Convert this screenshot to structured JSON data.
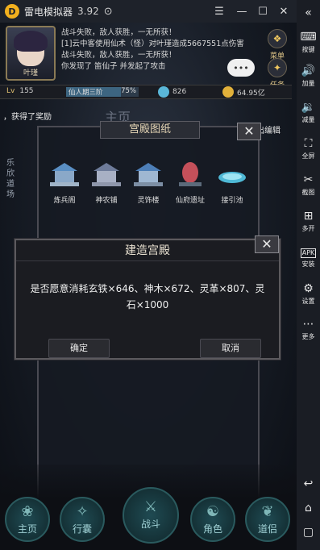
{
  "emulator": {
    "app_name": "雷电模拟器",
    "version": "3.92",
    "logo_glyph": "D",
    "window_buttons": [
      "☰",
      "—",
      "☐",
      "✕"
    ],
    "sidebar": [
      {
        "icon": "«",
        "label": ""
      },
      {
        "icon": "⌨",
        "label": "按键"
      },
      {
        "icon": "🔊",
        "label": "加量"
      },
      {
        "icon": "🔉",
        "label": "减量"
      },
      {
        "icon": "⛶",
        "label": "全屏"
      },
      {
        "icon": "✂",
        "label": "截图"
      },
      {
        "icon": "⊞",
        "label": "多开"
      },
      {
        "icon": "APK",
        "label": "安装"
      },
      {
        "icon": "⚙",
        "label": "设置"
      },
      {
        "icon": "⋯",
        "label": "更多"
      },
      {
        "icon": "↩",
        "label": ""
      },
      {
        "icon": "⌂",
        "label": ""
      },
      {
        "icon": "▢",
        "label": ""
      }
    ]
  },
  "player": {
    "name": "叶瑾",
    "level_label": "Lv",
    "level": "155",
    "realm": "仙人期三阶",
    "realm_progress": "75%",
    "realm_progress_value": 75,
    "spirit_stone": "826",
    "gold": "64.95亿"
  },
  "combat_log": [
    "战斗失败，敌人获胜，一无所获！",
    "[1]云中客使用仙术（怪）对叶瑾造成5667551点伤害",
    "战斗失败，敌人获胜，一无所获！",
    "你发现了 笛仙子 并发起了攻击"
  ],
  "top_buttons": {
    "menu": "菜单",
    "task": "任务",
    "chat_bubble": "•••"
  },
  "notices": {
    "got_reward": "，获得了奖励",
    "main_bg": "主页",
    "side_tab": "乐欣道场",
    "edit": "出编辑"
  },
  "blueprint_panel": {
    "title": "宫殿图纸",
    "buildings": [
      {
        "label": "炼兵阁"
      },
      {
        "label": "神农铺"
      },
      {
        "label": "灵饰楼"
      },
      {
        "label": "仙府遗址"
      },
      {
        "label": "接引池"
      }
    ]
  },
  "build_dialog": {
    "title": "建造宫殿",
    "message": "是否愿意消耗玄铁×646、神木×672、灵革×807、灵石×1000",
    "confirm": "确定",
    "cancel": "取消"
  },
  "close_glyph": "✕",
  "bottom_nav": [
    {
      "label": "主页",
      "icon": "❀"
    },
    {
      "label": "行囊",
      "icon": "✧"
    },
    {
      "label": "战斗",
      "icon": "⚔"
    },
    {
      "label": "角色",
      "icon": "☯"
    },
    {
      "label": "道侣",
      "icon": "❦"
    }
  ],
  "colors": {
    "titlebar_bg": "#1e222a",
    "sidebar_bg": "#1a1d24",
    "accent_gold": "#e2c88a",
    "nav_teal": "#2a5a5e"
  }
}
